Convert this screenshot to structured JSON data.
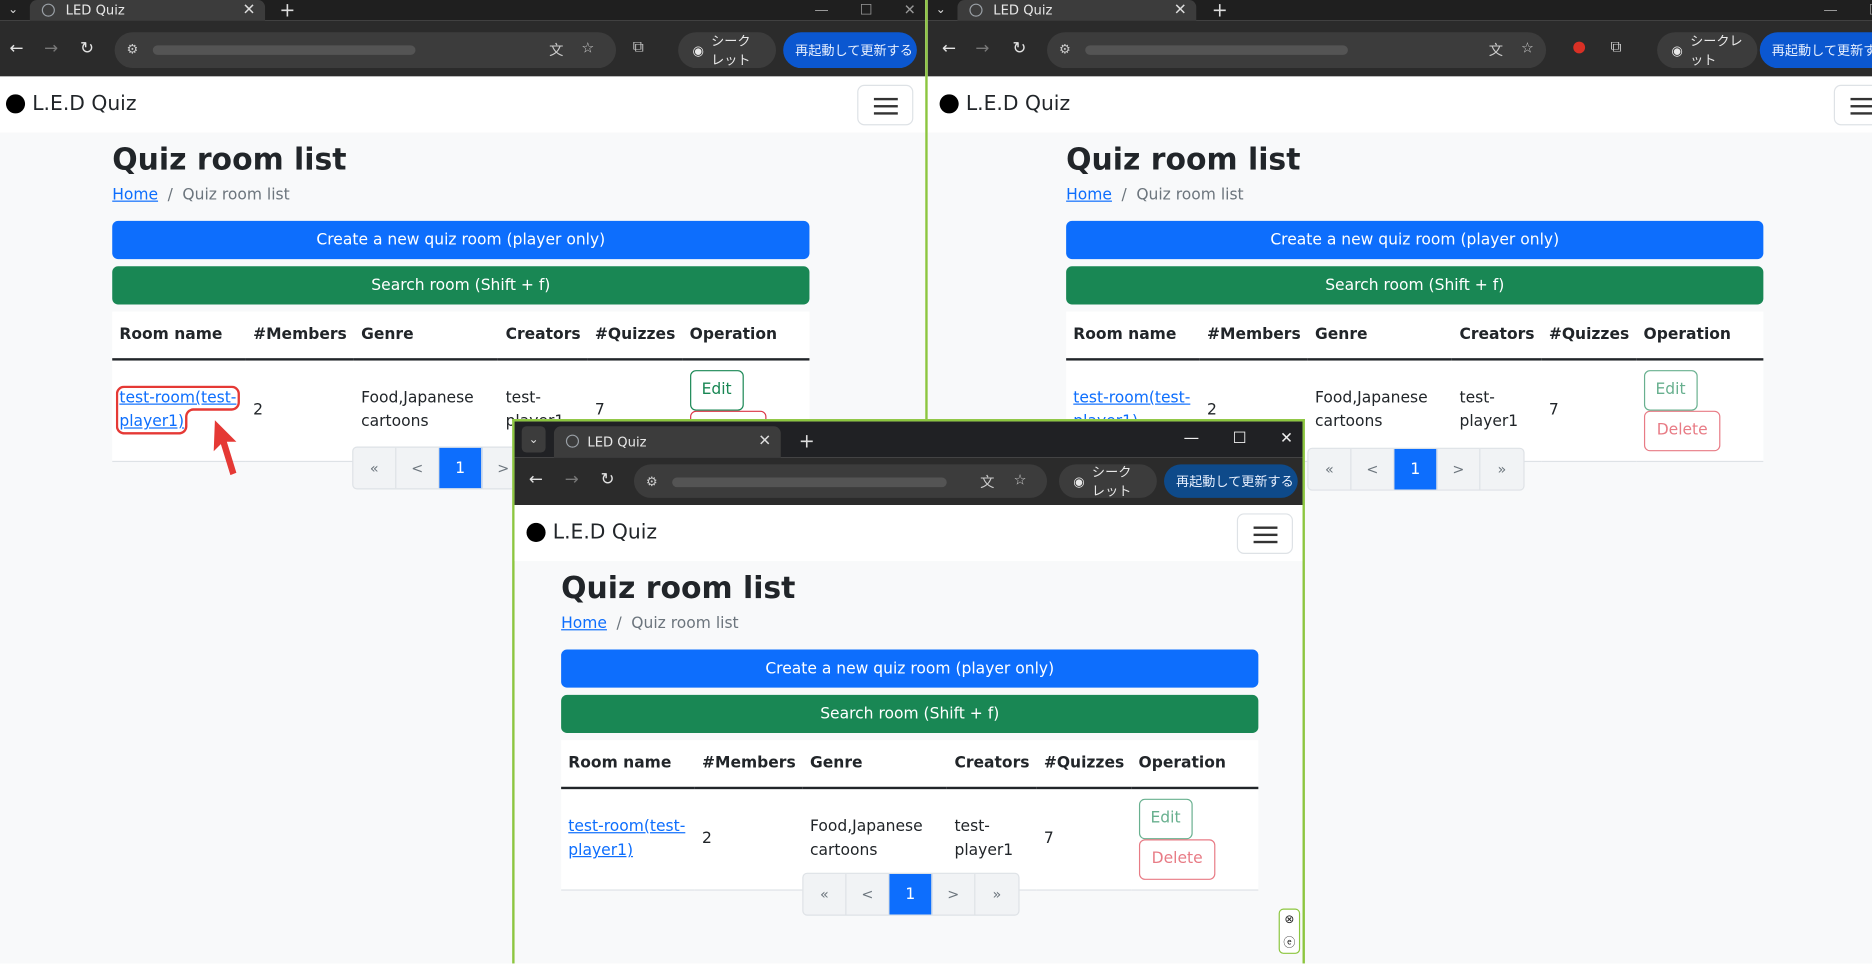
{
  "browser": {
    "tab_title": "LED Quiz",
    "incognito_label": "シークレット",
    "update_label": "再起動して更新する"
  },
  "site": {
    "brand": "L.E.D Quiz",
    "page_title": "Quiz room list",
    "breadcrumb_home": "Home",
    "breadcrumb_sep": "/",
    "breadcrumb_current": "Quiz room list",
    "create_button": "Create a new quiz room (player only)",
    "search_button": "Search room (Shift + f)"
  },
  "table": {
    "headers": [
      "Room name",
      "#Members",
      "Genre",
      "Creators",
      "#Quizzes",
      "Operation"
    ],
    "row": {
      "room_name_line1": "test-room(test-",
      "room_name_line2": "player1)",
      "members": "2",
      "genre_line1": "Food,Japanese",
      "genre_line2": "cartoons",
      "creators_line1": "test-",
      "creators_line2": "player1",
      "quizzes": "7",
      "edit_label": "Edit",
      "delete_label": "Delete"
    }
  },
  "pagination": {
    "first": "«",
    "prev": "<",
    "current": "1",
    "next": ">",
    "last": "»"
  },
  "colors": {
    "primary": "#0d6efd",
    "success": "#198754",
    "danger": "#dc3545",
    "window_border": "#8cc63f",
    "highlight": "#e53935"
  }
}
